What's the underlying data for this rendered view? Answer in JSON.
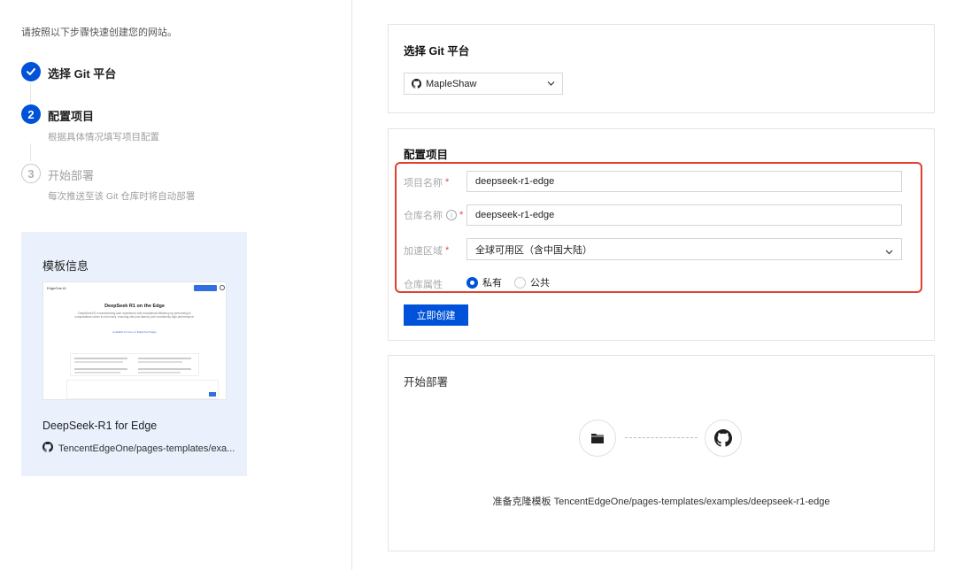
{
  "intro": "请按照以下步骤快速创建您的网站。",
  "steps": [
    {
      "index": "✓",
      "title": "选择 Git 平台",
      "desc": ""
    },
    {
      "index": "2",
      "title": "配置项目",
      "desc": "根据具体情况填写项目配置"
    },
    {
      "index": "3",
      "title": "开始部署",
      "desc": "每次推送至该 Git 仓库时将自动部署"
    }
  ],
  "template": {
    "title": "模板信息",
    "name": "DeepSeek-R1 for Edge",
    "repo": "TencentEdgeOne/pages-templates/exa...",
    "preview": {
      "brand": "EdgeOne AI",
      "heading": "DeepSeek R1 on the Edge",
      "paragraph": "DeepSeek-R1 is transforming user experience with exceptional efficiency by performing AI computations closer to end users, ensuring ultra-low latency and consistently high performance.",
      "cta": "Available for free on EdgeOne Pages"
    }
  },
  "git_card": {
    "title": "选择 Git 平台",
    "account": "MapleShaw"
  },
  "config_card": {
    "title": "配置项目",
    "fields": {
      "project_name": {
        "label": "项目名称",
        "value": "deepseek-r1-edge"
      },
      "repo_name": {
        "label": "仓库名称",
        "value": "deepseek-r1-edge"
      },
      "region": {
        "label": "加速区域",
        "value": "全球可用区（含中国大陆）"
      },
      "visibility": {
        "label": "仓库属性",
        "options": [
          "私有",
          "公共"
        ],
        "selected": "私有"
      }
    },
    "create_button": "立即创建"
  },
  "deploy_card": {
    "title": "开始部署",
    "clone_text": "准备克隆模板 TencentEdgeOne/pages-templates/examples/deepseek-r1-edge"
  },
  "colors": {
    "primary": "#0052d9",
    "highlight_border": "#e0412f",
    "template_bg": "#eaf1fd"
  },
  "icons": [
    "check-icon",
    "github-icon",
    "chevron-down-icon",
    "info-icon",
    "folder-icon"
  ]
}
